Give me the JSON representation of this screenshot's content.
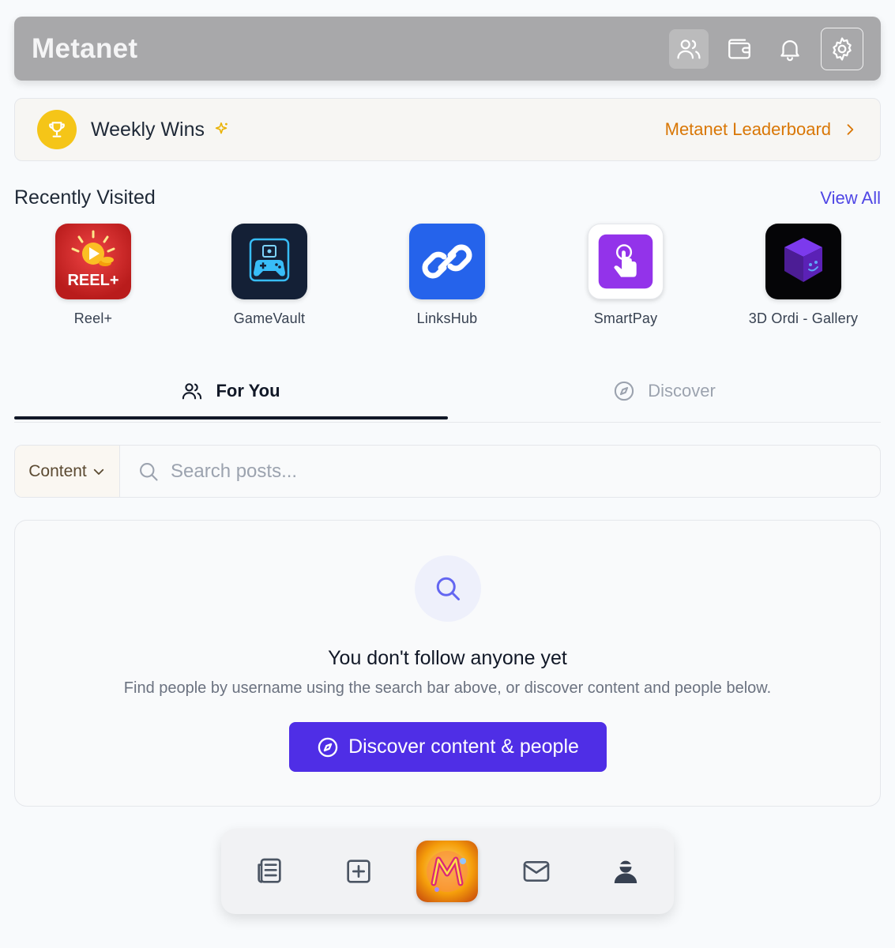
{
  "header": {
    "title": "Metanet"
  },
  "weekly": {
    "title": "Weekly Wins",
    "link_label": "Metanet Leaderboard"
  },
  "recent": {
    "title": "Recently Visited",
    "view_all": "View All",
    "apps": [
      {
        "label": "Reel+",
        "tile_text": "REEL+"
      },
      {
        "label": "GameVault"
      },
      {
        "label": "LinksHub"
      },
      {
        "label": "SmartPay"
      },
      {
        "label": "3D Ordi - Gallery"
      }
    ]
  },
  "tabs": [
    {
      "label": "For You",
      "active": true
    },
    {
      "label": "Discover",
      "active": false
    }
  ],
  "search": {
    "filter_value": "Content",
    "placeholder": "Search posts..."
  },
  "empty": {
    "title": "You don't follow anyone yet",
    "text": "Find people by username using the search bar above, or discover content and people below.",
    "button": "Discover content & people"
  },
  "colors": {
    "accent": "#4f2ee6",
    "link": "#4f46e5",
    "gold": "#d97706",
    "header": "#a8a8aa"
  }
}
